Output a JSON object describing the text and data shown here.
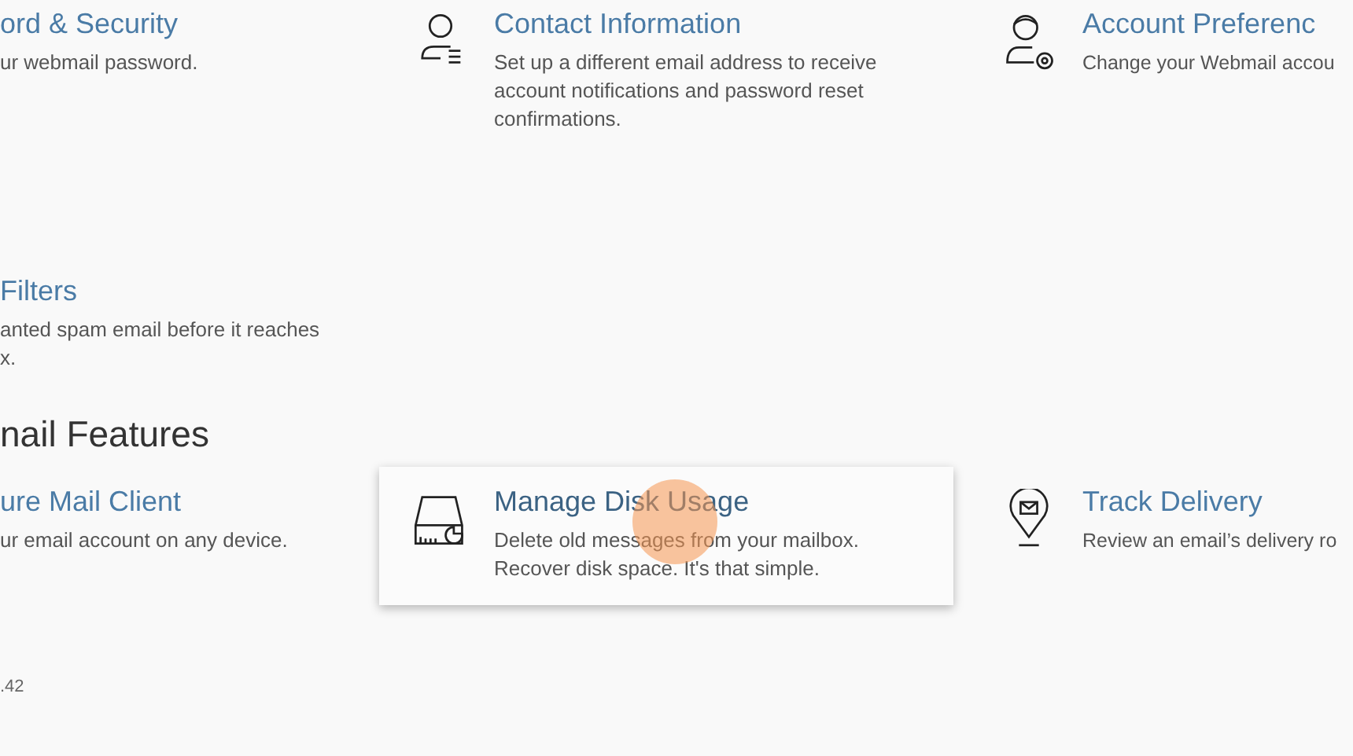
{
  "sections": [
    {
      "tiles": [
        {
          "title": "ord & Security",
          "description": "ur webmail password.",
          "hovered": false
        },
        {
          "title": "Contact Information",
          "description": "Set up a different email address to receive account notifications and password reset confirmations.",
          "hovered": false
        },
        {
          "title": "Account Preferenc",
          "description": "Change your Webmail accou",
          "hovered": false
        },
        {
          "title": "Filters",
          "description": "anted spam email before it reaches x.",
          "hovered": false
        }
      ]
    },
    {
      "heading": "nail Features",
      "tiles": [
        {
          "title": "ure Mail Client",
          "description": "ur email account on any device.",
          "hovered": false
        },
        {
          "title": "Manage Disk Usage",
          "description": "Delete old messages from your mailbox. Recover disk space. It's that simple.",
          "hovered": true
        },
        {
          "title": "Track Delivery",
          "description": "Review an email’s delivery ro",
          "hovered": false
        }
      ]
    }
  ],
  "footer": ".42"
}
